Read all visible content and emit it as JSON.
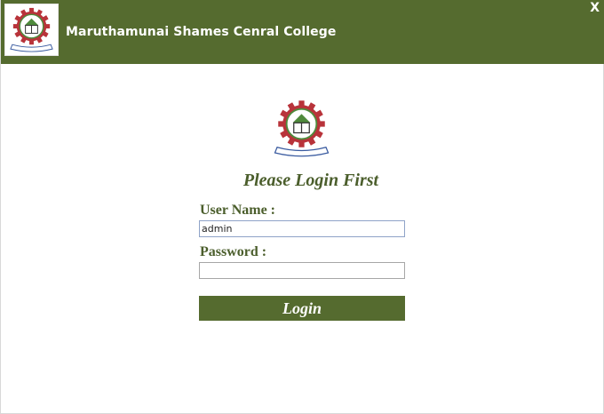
{
  "titlebar": {
    "title": "Maruthamunai Shames Cenral College",
    "close_label": "X",
    "logo_icon": "college-crest-icon"
  },
  "colors": {
    "brand": "#556b2f",
    "heading": "#4b5e2c",
    "crest_red": "#b8333a",
    "crest_green": "#4f8a3c"
  },
  "login": {
    "heading": "Please Login First",
    "username_label": "User Name :",
    "username_value": "admin",
    "password_label": "Password :",
    "password_value": "",
    "login_label": "Login"
  }
}
